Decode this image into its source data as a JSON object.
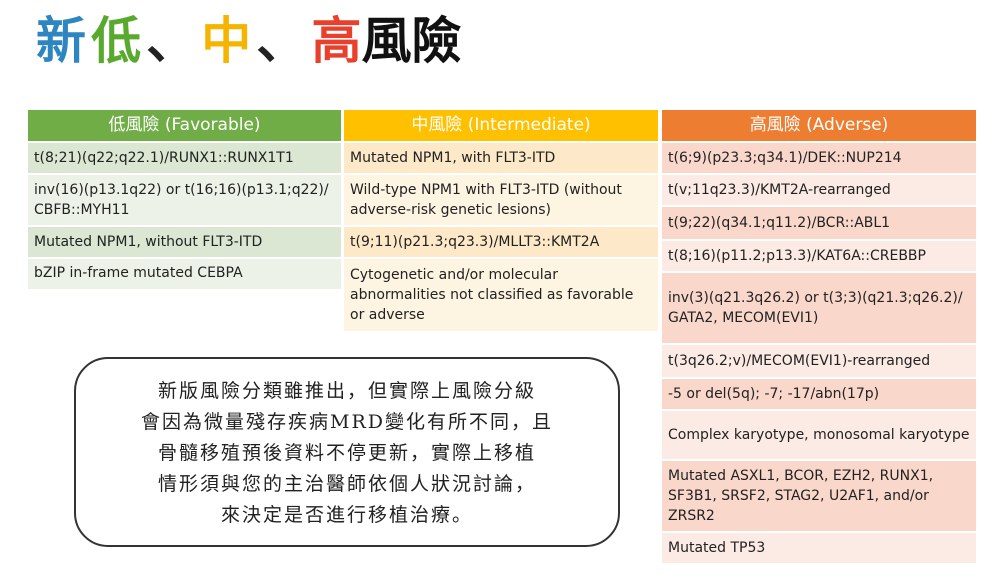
{
  "title": {
    "part_new": "新",
    "part_low": "低",
    "sep1": "、",
    "part_mid": "中",
    "sep2": "、",
    "part_high": "高",
    "part_rest": "風險"
  },
  "columns": {
    "favorable": {
      "header": "低風險 (Favorable)",
      "rows": [
        "t(8;21)(q22;q22.1)/RUNX1::RUNX1T1",
        "inv(16)(p13.1q22) or t(16;16)(p13.1;q22)/ CBFB::MYH11",
        "Mutated NPM1, without FLT3-ITD",
        "bZIP in-frame mutated CEBPA"
      ]
    },
    "intermediate": {
      "header": "中風險 (Intermediate)",
      "rows": [
        "Mutated NPM1, with FLT3-ITD",
        "Wild-type NPM1 with FLT3-ITD (without adverse-risk genetic lesions)",
        "t(9;11)(p21.3;q23.3)/MLLT3::KMT2A",
        "Cytogenetic and/or molecular abnormalities not classified as favorable or adverse"
      ]
    },
    "adverse": {
      "header": "高風險 (Adverse)",
      "rows": [
        "t(6;9)(p23.3;q34.1)/DEK::NUP214",
        "t(v;11q23.3)/KMT2A-rearranged",
        "t(9;22)(q34.1;q11.2)/BCR::ABL1",
        "t(8;16)(p11.2;p13.3)/KAT6A::CREBBP",
        "inv(3)(q21.3q26.2) or t(3;3)(q21.3;q26.2)/ GATA2, MECOM(EVI1)",
        "t(3q26.2;v)/MECOM(EVI1)-rearranged",
        "-5 or del(5q); -7; -17/abn(17p)",
        "Complex karyotype, monosomal karyotype",
        "Mutated ASXL1, BCOR, EZH2, RUNX1, SF3B1, SRSF2, STAG2, U2AF1, and/or ZRSR2",
        "Mutated TP53"
      ]
    }
  },
  "note": {
    "line1": "新版風險分類雖推出，但實際上風險分級",
    "line2": "會因為微量殘存疾病MRD變化有所不同，且",
    "line3": "骨髓移殖預後資料不停更新，實際上移植",
    "line4": "情形須與您的主治醫師依個人狀況討論，",
    "line5": "來決定是否進行移植治療。"
  },
  "colors": {
    "favorable_header": "#70ad47",
    "intermediate_header": "#ffc000",
    "adverse_header": "#ed7d31",
    "title_new": "#2e86c1",
    "title_low": "#5aa92f",
    "title_mid": "#f4b400",
    "title_high": "#e8402c"
  }
}
